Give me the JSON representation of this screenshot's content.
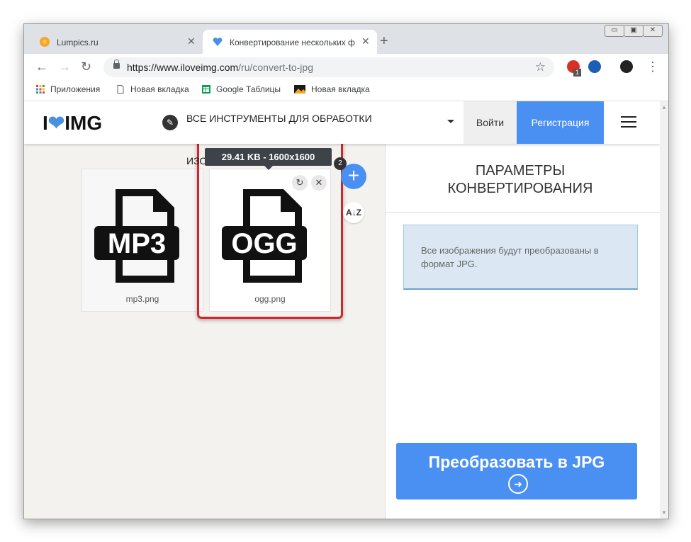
{
  "browser": {
    "tabs": [
      {
        "title": "Lumpics.ru",
        "close": "✕"
      },
      {
        "title": "Конвертирование нескольких ф",
        "close": "✕"
      }
    ],
    "new_tab": "+",
    "window_controls": {
      "minimize": "▭",
      "maximize": "▣",
      "close": "✕"
    },
    "nav": {
      "back": "←",
      "forward": "→",
      "reload": "↻"
    },
    "url": {
      "host": "https://www.iloveimg.com",
      "path": "/ru/convert-to-jpg"
    },
    "bookmark_star": "☆",
    "extension_badge": "1",
    "menu": "⋮",
    "bookmarks": [
      {
        "label": "Приложения"
      },
      {
        "label": "Новая вкладка"
      },
      {
        "label": "Google Таблицы"
      },
      {
        "label": "Новая вкладка"
      }
    ]
  },
  "site": {
    "logo": {
      "left": "I",
      "right": "IMG",
      "heart": "❤"
    },
    "all_tools": "Все инструменты для обработки изображений",
    "login": "Войти",
    "register": "Регистрация"
  },
  "files": [
    {
      "name": "mp3.png",
      "format": "MP3"
    },
    {
      "name": "ogg.png",
      "format": "OGG"
    }
  ],
  "tooltip": "29.41 KB - 1600x1600",
  "controls": {
    "add": "+",
    "count": "2",
    "sort": "A↓Z",
    "rotate": "↻",
    "remove": "✕"
  },
  "sidebar": {
    "title_line1": "ПАРАМЕТРЫ",
    "title_line2": "КОНВЕРТИРОВАНИЯ",
    "info": "Все изображения будут преобразованы в формат JPG.",
    "convert_button": "Преобразовать в JPG",
    "convert_arrow": "➜"
  },
  "colors": {
    "accent": "#4a90f2",
    "highlight": "#d3232b"
  }
}
